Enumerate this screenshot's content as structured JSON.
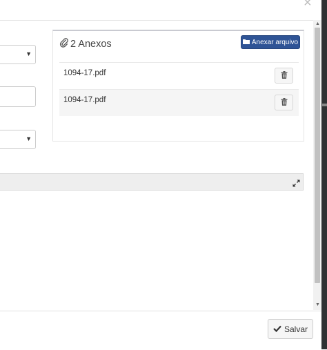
{
  "window": {
    "close_glyph": "×"
  },
  "attachments_panel": {
    "title": "2 Anexos",
    "title_icon": "paperclip-icon",
    "attach_button": {
      "label": "Anexar arquivo",
      "icon": "folder-icon"
    },
    "files": [
      {
        "name": "1094-17.pdf",
        "delete_icon": "trash-icon"
      },
      {
        "name": "1094-17.pdf",
        "delete_icon": "trash-icon"
      }
    ]
  },
  "section_bar": {
    "icon": "expand-icon"
  },
  "footer": {
    "save_button": {
      "label": "Salvar",
      "icon": "check-icon"
    }
  },
  "colors": {
    "primary": "#2f5496",
    "panel_border": "#c9cad1",
    "row_alt": "#f5f5f5"
  }
}
